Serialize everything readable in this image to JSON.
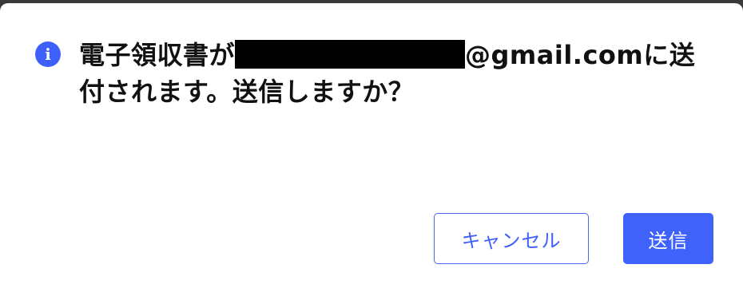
{
  "dialog": {
    "icon": "info-icon",
    "icon_glyph": "i",
    "message_prefix": "電子領収書が",
    "message_email_suffix": "@gmail.comに送付されます。送信しますか？",
    "cancel_label": "キャンセル",
    "send_label": "送信"
  },
  "colors": {
    "accent": "#3f5ffb",
    "backdrop": "#3a3a3a",
    "text": "#111111"
  }
}
